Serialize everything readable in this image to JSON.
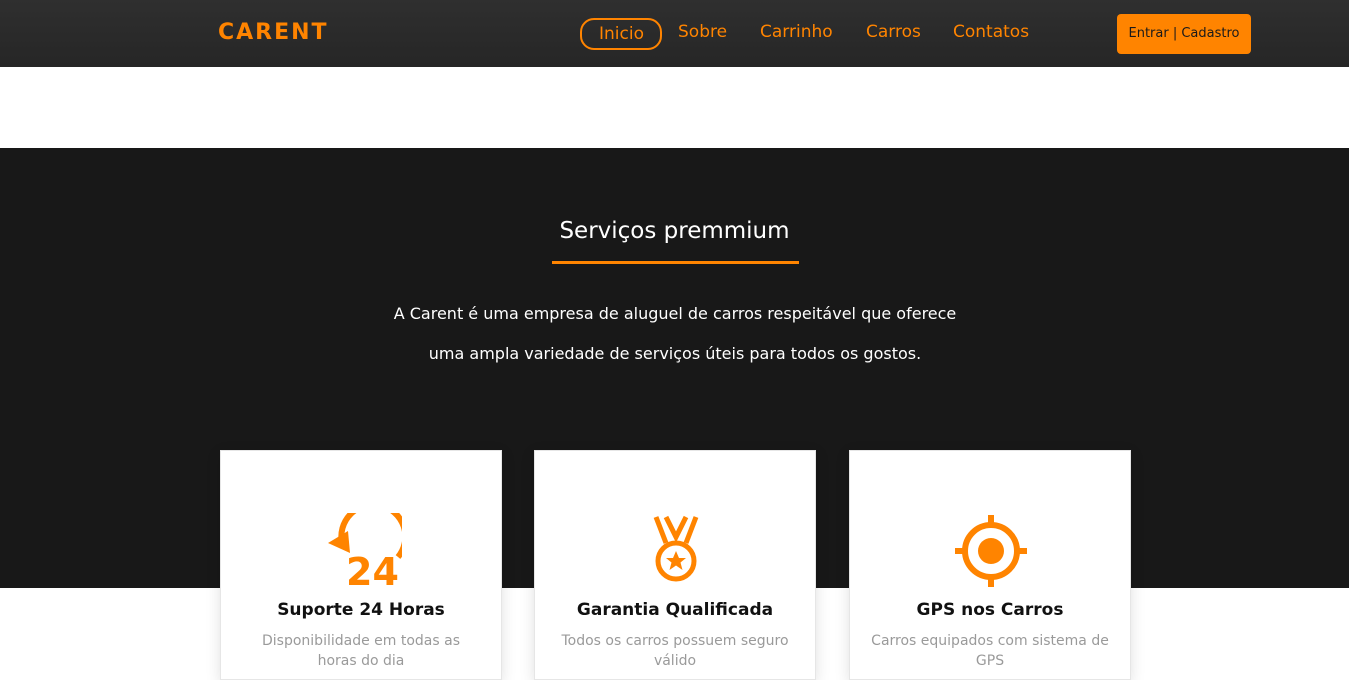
{
  "brand": {
    "logo": "CARENT",
    "accent_color": "#ff8400"
  },
  "nav": {
    "items": [
      {
        "label": "Inicio",
        "active": true
      },
      {
        "label": "Sobre",
        "active": false
      },
      {
        "label": "Carrinho",
        "active": false
      },
      {
        "label": "Carros",
        "active": false
      },
      {
        "label": "Contatos",
        "active": false
      }
    ],
    "login_label": "Entrar | Cadastro"
  },
  "services": {
    "title": "Serviços premmium",
    "description_line1": "A Carent é uma empresa de aluguel de carros respeitável que oferece",
    "description_line2": "uma ampla variedade de serviços úteis para todos os gostos.",
    "cards": [
      {
        "icon": "support-24h-icon",
        "title": "Suporte 24 Horas",
        "text": "Disponibilidade em todas as horas do dia"
      },
      {
        "icon": "medal-icon",
        "title": "Garantia Qualificada",
        "text": "Todos os carros possuem seguro válido"
      },
      {
        "icon": "gps-target-icon",
        "title": "GPS nos Carros",
        "text": "Carros equipados com sistema de GPS"
      }
    ]
  }
}
